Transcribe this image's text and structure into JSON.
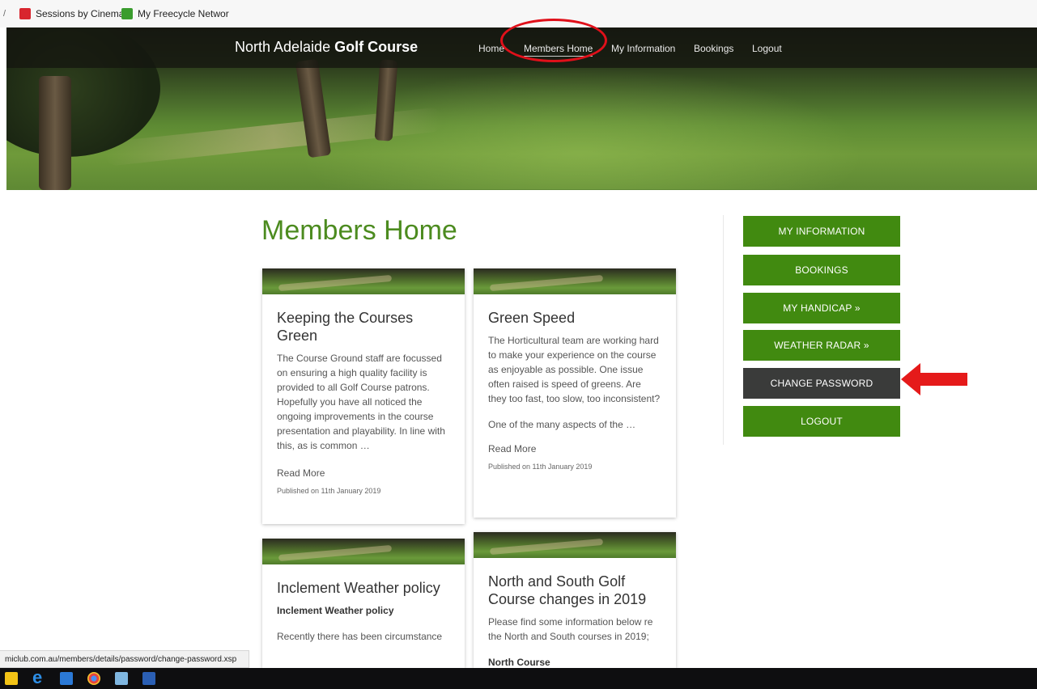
{
  "bookmarks": {
    "items": [
      {
        "label": "Sessions by Cinema |",
        "icon": "cinema-logo-icon"
      },
      {
        "label": "My Freecycle Networ",
        "icon": "freecycle-logo-icon"
      }
    ]
  },
  "brand": {
    "name_light": "North Adelaide ",
    "name_bold": "Golf Course"
  },
  "nav": {
    "items": [
      {
        "label": "Home"
      },
      {
        "label": "Members Home",
        "active": true
      },
      {
        "label": "My Information"
      },
      {
        "label": "Bookings"
      },
      {
        "label": "Logout"
      }
    ]
  },
  "main": {
    "title": "Members Home",
    "cards": [
      {
        "title": "Keeping the Courses Green",
        "excerpt": "The Course Ground staff are focussed on ensuring a high quality facility is provided to all Golf Course patrons. Hopefully you have all noticed the ongoing improvements in the course presentation and playability. In line with this, as is common …",
        "read_more": "Read More",
        "published": "Published on 11th January 2019"
      },
      {
        "title": "Green Speed",
        "excerpt": "The Horticultural team are working hard to make your experience on the course as enjoyable as possible. One issue often raised is speed of greens. Are they too fast, too slow, too inconsistent?",
        "excerpt2": "One of the many aspects of the …",
        "read_more": "Read More",
        "published": "Published on 11th January 2019"
      },
      {
        "title": "Inclement Weather policy",
        "subhead": "Inclement Weather policy",
        "excerpt": "Recently there has been circumstance"
      },
      {
        "title": "North and South Golf Course changes in 2019",
        "excerpt": "Please find some information below re the North and South courses in 2019;",
        "subhead": "North Course"
      }
    ]
  },
  "sidebar": {
    "buttons": [
      {
        "label": "MY INFORMATION"
      },
      {
        "label": "BOOKINGS"
      },
      {
        "label": "MY HANDICAP »"
      },
      {
        "label": "WEATHER RADAR »"
      },
      {
        "label": "CHANGE PASSWORD",
        "highlighted": true
      },
      {
        "label": "LOGOUT"
      }
    ]
  },
  "status_bar": {
    "url": "miclub.com.au/members/details/password/change-password.xsp"
  },
  "colors": {
    "accent_green": "#418a10",
    "title_green": "#4c8b1f",
    "dark_button": "#3a3b3a",
    "annotation_red": "#e0101a"
  },
  "taskbar": {
    "icons": [
      "file-explorer-icon",
      "edge-icon",
      "store-icon",
      "chrome-icon",
      "photos-icon",
      "word-icon"
    ]
  }
}
